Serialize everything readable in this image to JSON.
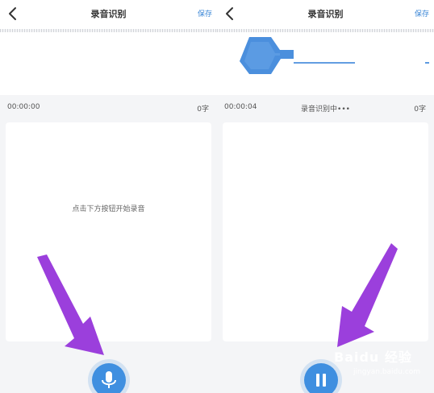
{
  "left_panel": {
    "title": "录音识别",
    "save_label": "保存",
    "time": "00:00:00",
    "status": "",
    "count": "0字",
    "hint": "点击下方按钮开始录音",
    "button_icon": "microphone-icon"
  },
  "right_panel": {
    "title": "录音识别",
    "save_label": "保存",
    "time": "00:00:04",
    "status": "录音识别中•••",
    "count": "0字",
    "button_icon": "pause-icon"
  },
  "watermark": {
    "main": "Baidu 经验",
    "sub": "jingyan.baidu.com"
  },
  "colors": {
    "accent": "#3f8fe0",
    "arrow": "#9b3fdc",
    "background": "#f4f5f7"
  }
}
